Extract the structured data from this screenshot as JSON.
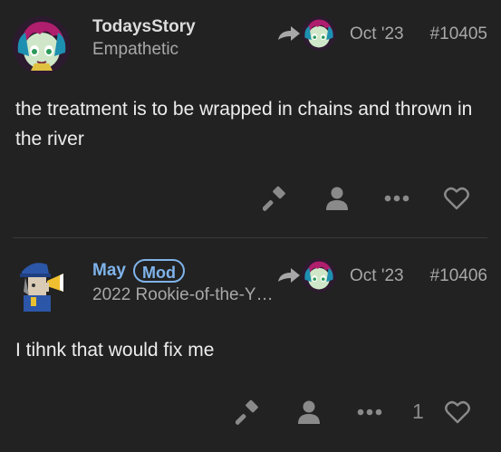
{
  "posts": [
    {
      "username": "TodaysStory",
      "user_title": "Empathetic",
      "badge": "",
      "date": "Oct '23",
      "post_number": "#10405",
      "body": "the treatment is to be wrapped in chains and thrown in the river",
      "like_count": "",
      "icons": {
        "avatar": "character-avatar",
        "reply_to": "reply-arrow-icon",
        "flag": "gavel-icon",
        "user": "user-icon",
        "more": "ellipsis-icon",
        "like": "heart-icon"
      }
    },
    {
      "username": "May",
      "user_title": "2022 Rookie-of-the-Y…",
      "badge": "Mod",
      "date": "Oct '23",
      "post_number": "#10406",
      "body": "I tihnk that would fix me",
      "like_count": "1",
      "icons": {
        "avatar": "character-avatar",
        "reply_to": "reply-arrow-icon",
        "flag": "gavel-icon",
        "user": "user-icon",
        "more": "ellipsis-icon",
        "like": "heart-icon"
      }
    }
  ],
  "colors": {
    "background": "#222222",
    "text": "#ededed",
    "muted": "#a8a8a8",
    "mod_accent": "#7fb3ea",
    "icon": "#8a8a8a"
  }
}
